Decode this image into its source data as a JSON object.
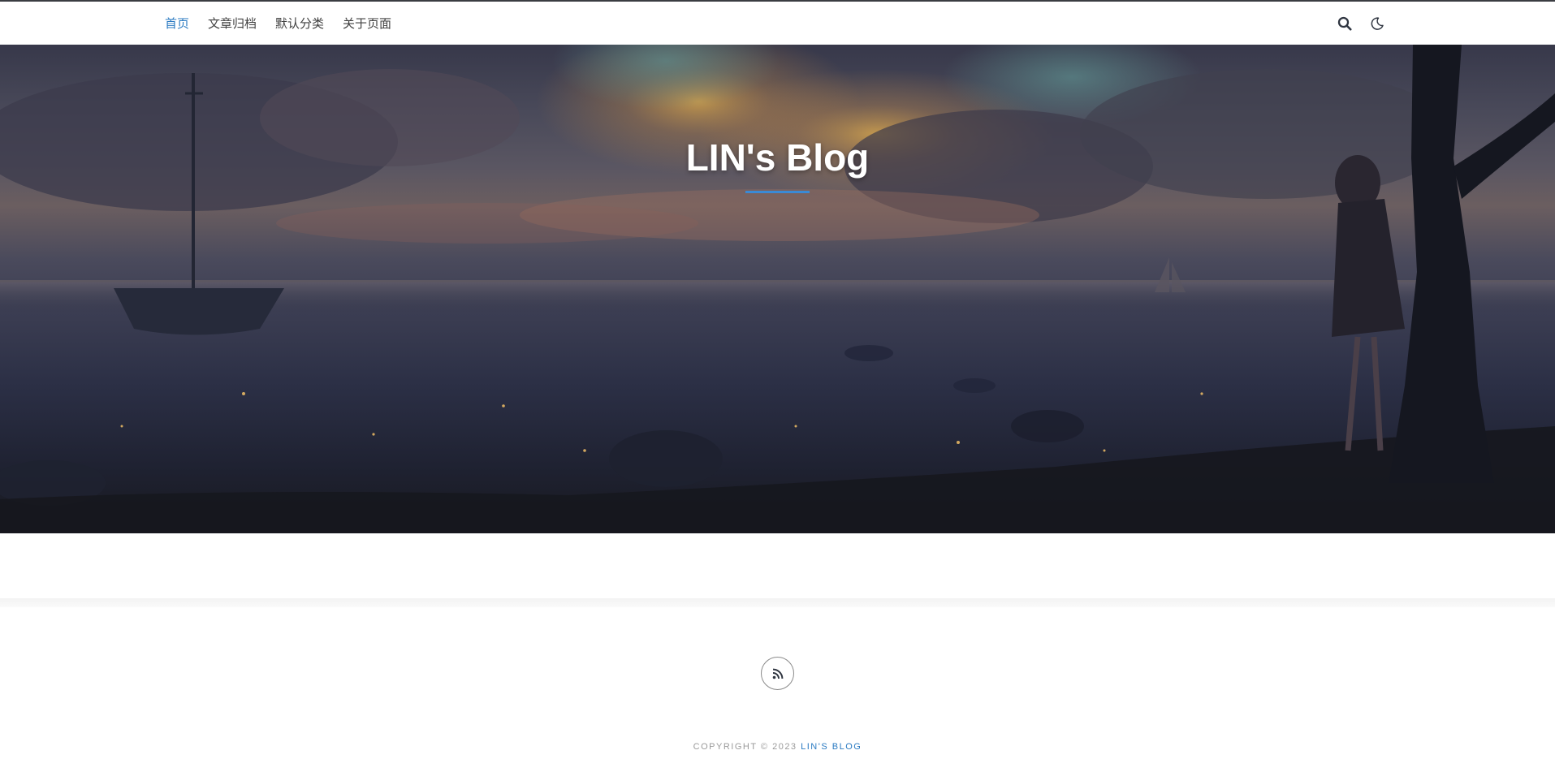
{
  "nav": {
    "items": [
      {
        "label": "首页",
        "active": true
      },
      {
        "label": "文章归档",
        "active": false
      },
      {
        "label": "默认分类",
        "active": false
      },
      {
        "label": "关于页面",
        "active": false
      }
    ],
    "search_icon": "search-icon",
    "theme_icon": "moon-icon"
  },
  "hero": {
    "title": "LIN's Blog",
    "background": "sunset-lake-illustration",
    "underline_color": "#3a8ad6"
  },
  "footer": {
    "rss_icon": "rss-icon",
    "copyright_prefix": "COPYRIGHT © 2023",
    "site_link": "LIN'S BLOG"
  },
  "colors": {
    "accent": "#2a7ac2",
    "nav_text": "#404040"
  }
}
